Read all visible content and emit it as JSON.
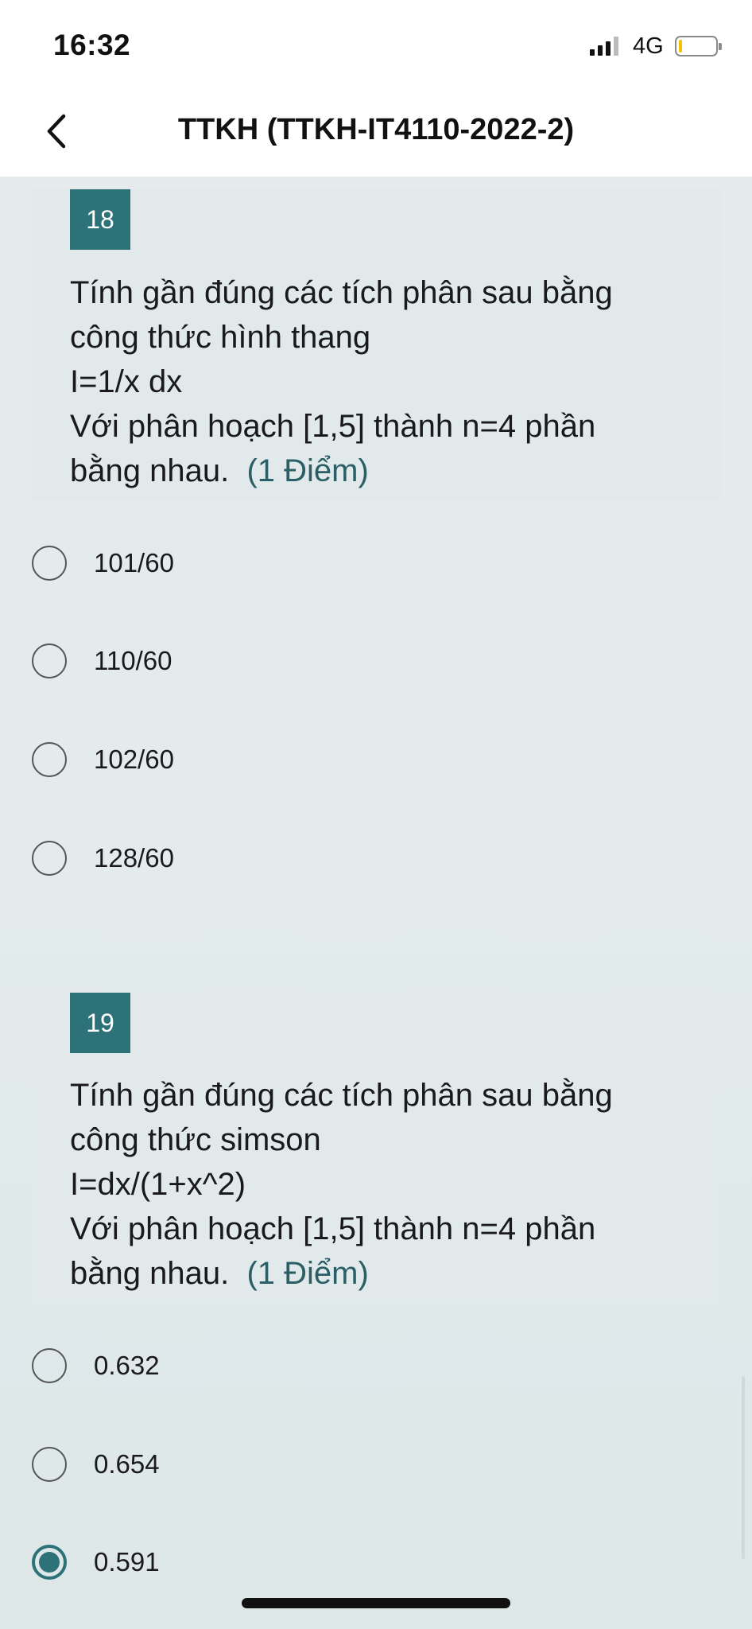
{
  "status_bar": {
    "time": "16:32",
    "network": "4G"
  },
  "nav": {
    "title": "TTKH (TTKH-IT4110-2022-2)"
  },
  "questions": [
    {
      "number": "18",
      "lines": [
        "Tính gần đúng các tích phân sau bằng",
        "công thức hình thang",
        "I=1/x dx",
        "Với phân hoạch [1,5] thành n=4 phần"
      ],
      "last_line": "bằng nhau.",
      "points": "(1 Điểm)",
      "options": [
        "101/60",
        "110/60",
        "102/60",
        "128/60"
      ],
      "selected": null
    },
    {
      "number": "19",
      "lines": [
        "Tính gần đúng các tích phân sau bằng",
        "công thức simson",
        "I=dx/(1+x^2)",
        "Với phân hoạch [1,5] thành n=4 phần"
      ],
      "last_line": "bằng nhau.",
      "points": "(1 Điểm)",
      "options": [
        "0.632",
        "0.654",
        "0.591"
      ],
      "selected": 2
    }
  ],
  "colors": {
    "accent": "#2c7278",
    "points": "#2a5f66",
    "background": "#e5ebed"
  }
}
